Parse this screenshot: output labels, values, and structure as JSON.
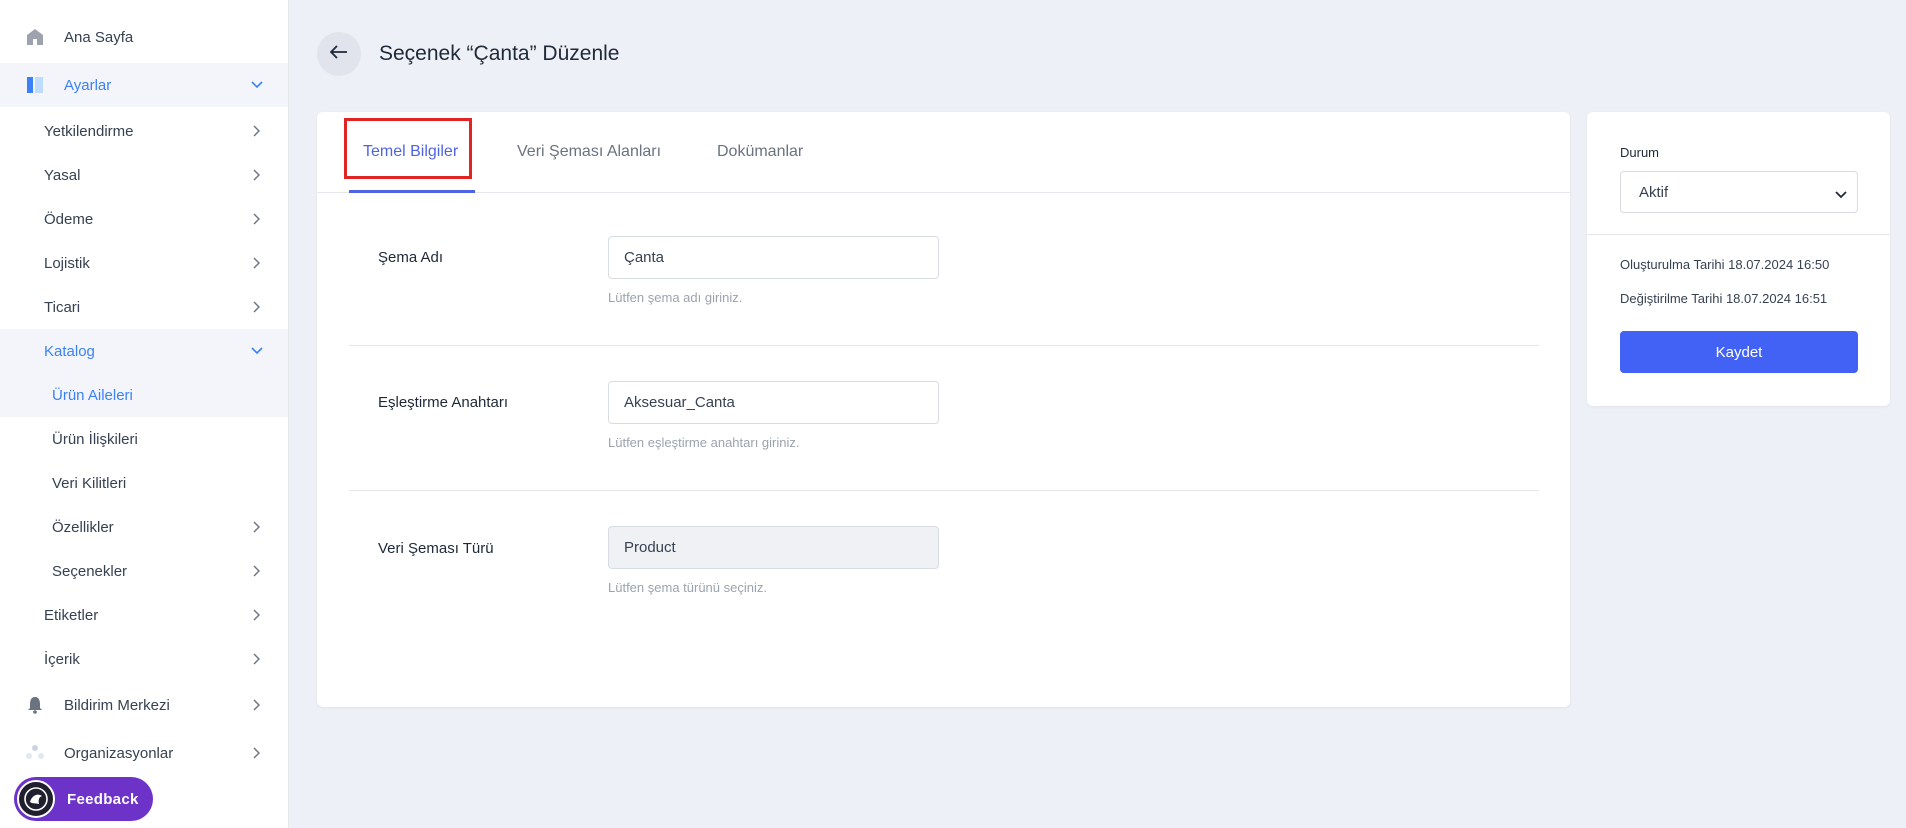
{
  "sidebar": {
    "home": "Ana Sayfa",
    "settings": "Ayarlar",
    "items": {
      "yetkilendirme": "Yetkilendirme",
      "yasal": "Yasal",
      "odeme": "Ödeme",
      "lojistik": "Lojistik",
      "ticari": "Ticari",
      "katalog": "Katalog",
      "urun_aileleri": "Ürün Aileleri",
      "urun_iliskileri": "Ürün İlişkileri",
      "veri_kilitleri": "Veri Kilitleri",
      "ozellikler": "Özellikler",
      "secenekler": "Seçenekler",
      "etiketler": "Etiketler",
      "icerik": "İçerik"
    },
    "notifications": "Bildirim Merkezi",
    "organizations": "Organizasyonlar",
    "feedback": "Feedback"
  },
  "header": {
    "title": "Seçenek “Çanta” Düzenle"
  },
  "tabs": [
    "Temel Bilgiler",
    "Veri Şeması Alanları",
    "Dokümanlar"
  ],
  "form": {
    "schema_name": {
      "label": "Şema Adı",
      "value": "Çanta",
      "help": "Lütfen şema adı giriniz."
    },
    "match_key": {
      "label": "Eşleştirme Anahtarı",
      "value": "Aksesuar_Canta",
      "help": "Lütfen eşleştirme anahtarı giriniz."
    },
    "schema_type": {
      "label": "Veri Şeması Türü",
      "value": "Product",
      "help": "Lütfen şema türünü seçiniz."
    }
  },
  "status_panel": {
    "label": "Durum",
    "selected": "Aktif",
    "created": "Oluşturulma Tarihi 18.07.2024 16:50",
    "modified": "Değiştirilme Tarihi 18.07.2024 16:51",
    "save": "Kaydet"
  },
  "colors": {
    "accent": "#4f63e7",
    "button": "#4162f5",
    "feedback": "#6d32c8",
    "highlight": "#e02424"
  }
}
